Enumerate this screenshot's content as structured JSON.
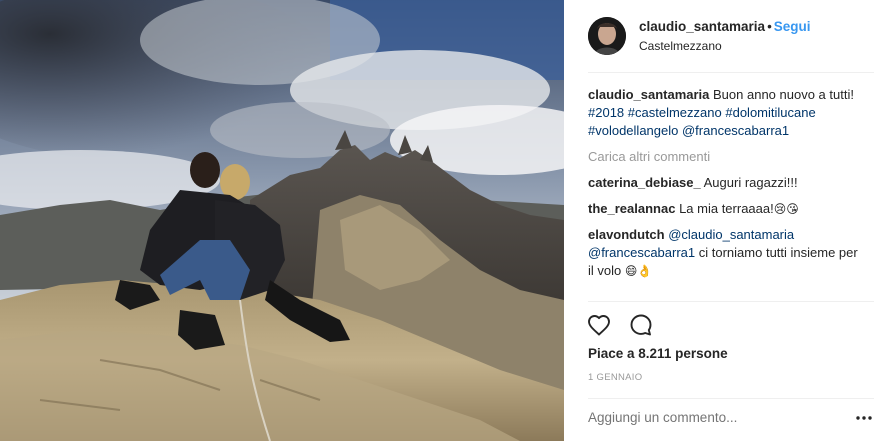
{
  "post": {
    "image_alt": "Foto di una coppia seduta su una roccia in montagna",
    "username": "claudio_santamaria",
    "separator": "•",
    "follow_label": "Segui",
    "location": "Castelmezzano"
  },
  "caption": {
    "author": "claudio_santamaria",
    "text": "Buon anno nuovo a tutti!",
    "hashtags": [
      "#2018",
      "#castelmezzano",
      "#dolomitilucane",
      "#volodellangelo"
    ],
    "mention": "@francescabarra1"
  },
  "load_more_label": "Carica altri commenti",
  "comments": [
    {
      "author": "caterina_debiase_",
      "text": "Auguri ragazzi!!!"
    },
    {
      "author": "the_realannac",
      "text": "La mia terraaaa!",
      "emoji": "😢😘"
    },
    {
      "author": "elavondutch",
      "mention1": "@claudio_santamaria",
      "mention2": "@francescabarra1",
      "text": "ci torniamo tutti insieme per il volo",
      "emoji": "😄👌"
    }
  ],
  "actions": {
    "like_icon": "heart-icon",
    "comment_icon": "comment-bubble-icon",
    "more_icon": "ellipsis-icon"
  },
  "likes_text": "Piace a 8.211 persone",
  "date_text": "1 GENNAIO",
  "add_comment_placeholder": "Aggiungi un commento...",
  "colors": {
    "link_blue": "#3897f0",
    "hashtag_navy": "#003569",
    "muted_gray": "#999999",
    "text": "#262626",
    "separator": "#efefef"
  }
}
